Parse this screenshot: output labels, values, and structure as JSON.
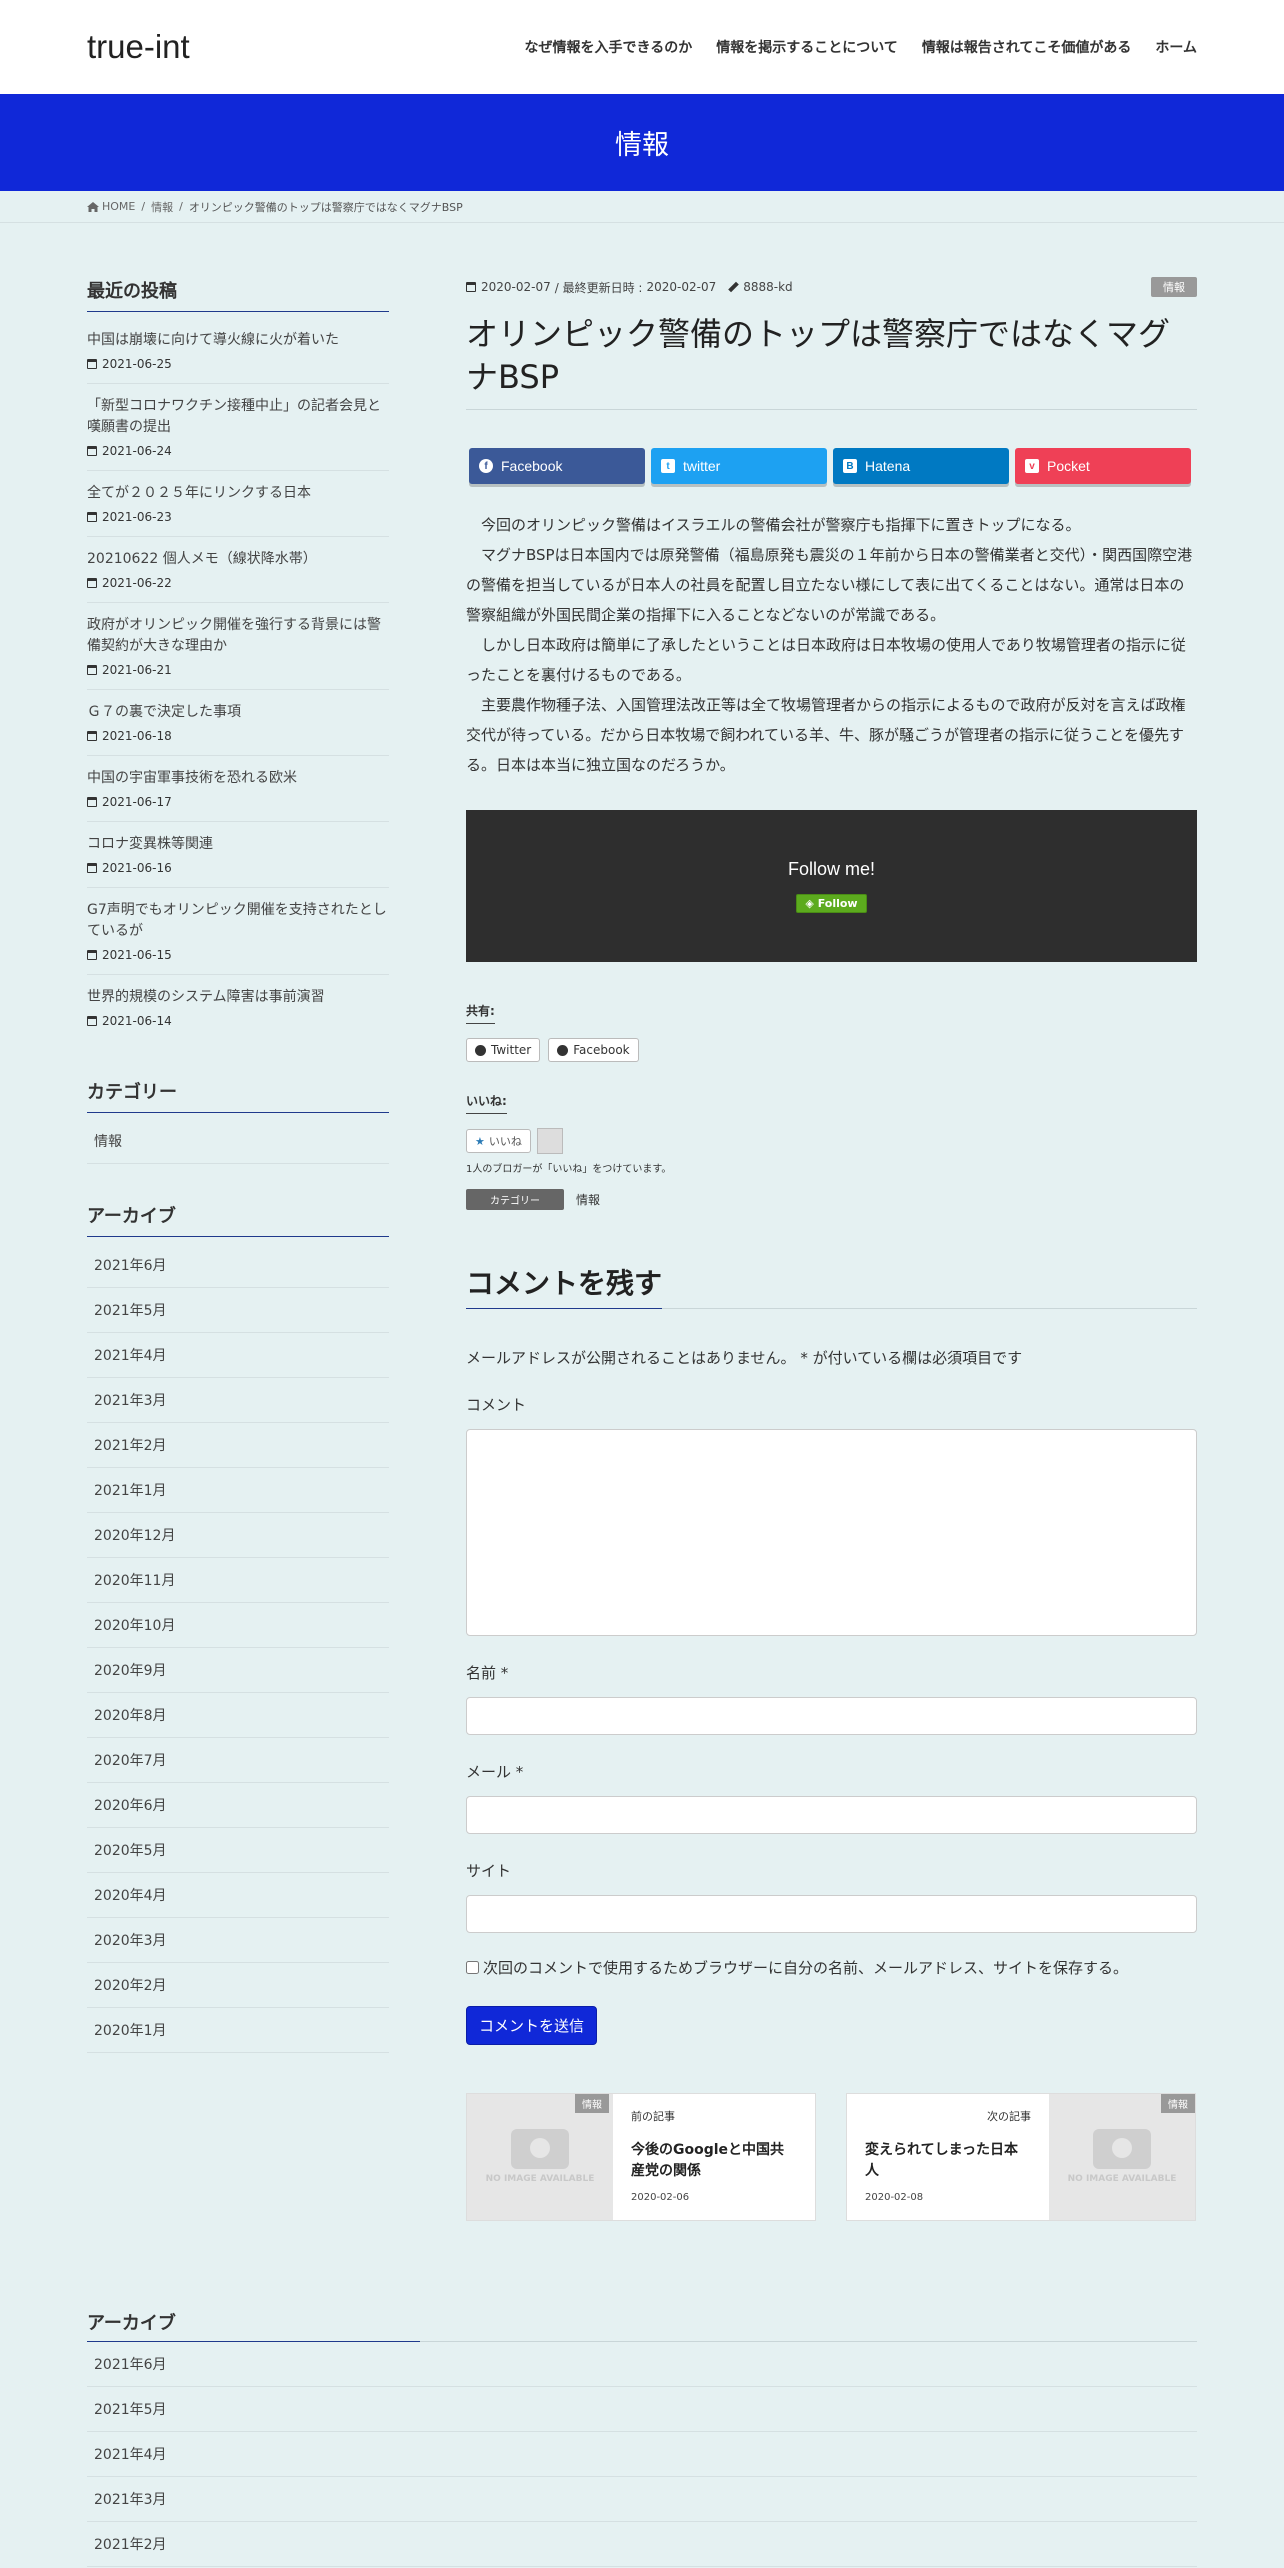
{
  "header": {
    "logo": "true-int",
    "nav": [
      "なぜ情報を入手できるのか",
      "情報を掲示することについて",
      "情報は報告されてこそ価値がある",
      "ホーム"
    ]
  },
  "page_header": {
    "title": "情報"
  },
  "breadcrumb": {
    "home": "HOME",
    "category": "情報",
    "current": "オリンピック警備のトップは警察庁ではなくマグナBSP"
  },
  "sidebar": {
    "recent_title": "最近の投稿",
    "recent": [
      {
        "title": "中国は崩壊に向けて導火線に火が着いた",
        "date": "2021-06-25"
      },
      {
        "title": "「新型コロナワクチン接種中止」の記者会見と嘆願書の提出",
        "date": "2021-06-24"
      },
      {
        "title": "全てが２０２５年にリンクする日本",
        "date": "2021-06-23"
      },
      {
        "title": "20210622 個人メモ（線状降水帯）",
        "date": "2021-06-22"
      },
      {
        "title": "政府がオリンピック開催を強行する背景には警備契約が大きな理由か",
        "date": "2021-06-21"
      },
      {
        "title": "Ｇ７の裏で決定した事項",
        "date": "2021-06-18"
      },
      {
        "title": "中国の宇宙軍事技術を恐れる欧米",
        "date": "2021-06-17"
      },
      {
        "title": "コロナ変異株等関連",
        "date": "2021-06-16"
      },
      {
        "title": "G7声明でもオリンピック開催を支持されたとしているが",
        "date": "2021-06-15"
      },
      {
        "title": "世界的規模のシステム障害は事前演習",
        "date": "2021-06-14"
      }
    ],
    "category_title": "カテゴリー",
    "categories": [
      "情報"
    ],
    "archive_title": "アーカイブ",
    "archives": [
      "2021年6月",
      "2021年5月",
      "2021年4月",
      "2021年3月",
      "2021年2月",
      "2021年1月",
      "2020年12月",
      "2020年11月",
      "2020年10月",
      "2020年9月",
      "2020年8月",
      "2020年7月",
      "2020年6月",
      "2020年5月",
      "2020年4月",
      "2020年3月",
      "2020年2月",
      "2020年1月"
    ]
  },
  "article": {
    "meta": {
      "date": "2020-02-07",
      "updated_label": "/ 最終更新日時 :",
      "updated": "2020-02-07",
      "author": "8888-kd",
      "category": "情報"
    },
    "title": "オリンピック警備のトップは警察庁ではなくマグナBSP",
    "share": {
      "facebook": "Facebook",
      "twitter": "twitter",
      "hatena": "Hatena",
      "pocket": "Pocket"
    },
    "body": [
      "今回のオリンピック警備はイスラエルの警備会社が警察庁も指揮下に置きトップになる。",
      "マグナBSPは日本国内では原発警備（福島原発も震災の１年前から日本の警備業者と交代）・関西国際空港の警備を担当しているが日本人の社員を配置し目立たない様にして表に出てくることはない。通常は日本の警察組織が外国民間企業の指揮下に入ることなどないのが常識である。",
      "しかし日本政府は簡単に了承したということは日本政府は日本牧場の使用人であり牧場管理者の指示に従ったことを裏付けるものである。",
      "主要農作物種子法、入国管理法改正等は全て牧場管理者からの指示によるもので政府が反対を言えば政権交代が待っている。だから日本牧場で飼われている羊、牛、豚が騒ごうが管理者の指示に従うことを優先する。日本は本当に独立国なのだろうか。"
    ],
    "follow": {
      "text": "Follow me!",
      "button": "Follow"
    },
    "sharedaddy": {
      "heading": "共有:",
      "twitter": "Twitter",
      "facebook": "Facebook"
    },
    "likes": {
      "heading": "いいね:",
      "button": "いいね",
      "note": "1人のブロガーが「いいね」をつけています。"
    },
    "category_row": {
      "label": "カテゴリー",
      "value": "情報"
    }
  },
  "comment_form": {
    "title": "コメントを残す",
    "notes": "メールアドレスが公開されることはありません。 * が付いている欄は必須項目です",
    "comment_label": "コメント",
    "name_label": "名前 *",
    "email_label": "メール *",
    "site_label": "サイト",
    "cookie_label": "次回のコメントで使用するためブラウザーに自分の名前、メールアドレス、サイトを保存する。",
    "submit": "コメントを送信"
  },
  "postnav": {
    "prev": {
      "caption": "前の記事",
      "title": "今後のGoogleと中国共産党の関係",
      "date": "2020-02-06",
      "badge": "情報"
    },
    "next": {
      "caption": "次の記事",
      "title": "変えられてしまった日本人",
      "date": "2020-02-08",
      "badge": "情報"
    },
    "noimage": "NO IMAGE AVAILABLE"
  },
  "footer": {
    "archive_title": "アーカイブ",
    "archives": [
      "2021年6月",
      "2021年5月",
      "2021年4月",
      "2021年3月",
      "2021年2月"
    ]
  }
}
